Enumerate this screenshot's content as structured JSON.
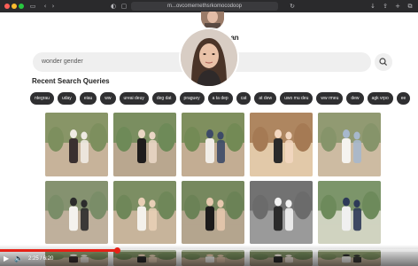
{
  "browser": {
    "url": "m...ovcomernethsrkomocodoop",
    "colors": {
      "close": "#ff5f57",
      "minimize": "#febc2e",
      "maximize": "#28c840"
    }
  },
  "profile": {
    "name_partial": "an"
  },
  "search": {
    "value": "wonder gender"
  },
  "recent": {
    "title": "Recent Search Queries",
    "chips": [
      "ntegrau",
      "uday",
      "eiau",
      "ww",
      "ureai deuy",
      "deg dat",
      "praguey",
      "a ta dep",
      "cat",
      "at dew",
      "uwo mu deu",
      "ww rmeu",
      "dew",
      "agk vrpo",
      "ee"
    ]
  },
  "gallery": {
    "photos": [
      {
        "icon": "couple-walking-desert-garden-photo"
      },
      {
        "icon": "woman-black-dress-cactus-garden-photo"
      },
      {
        "icon": "couple-holding-hands-cactus-photo"
      },
      {
        "icon": "toddler-portrait-photo"
      },
      {
        "icon": "woman-white-outfit-garden-photo"
      },
      {
        "icon": "couple-hands-white-dress-photo"
      },
      {
        "icon": "woman-white-dress-cactus-photo"
      },
      {
        "icon": "woman-sitting-black-dress-photo"
      },
      {
        "icon": "couple-standing-bw-photo"
      },
      {
        "icon": "man-patterned-shirt-portrait-photo"
      },
      {
        "icon": "bottom-row-photo"
      },
      {
        "icon": "bottom-row-photo"
      },
      {
        "icon": "bottom-row-photo"
      },
      {
        "icon": "bottom-row-photo"
      },
      {
        "icon": "bottom-row-photo"
      }
    ]
  },
  "video": {
    "current_time": "2:25",
    "duration": "6:20",
    "progress_fraction": 0.28,
    "accent": "#e62117"
  }
}
